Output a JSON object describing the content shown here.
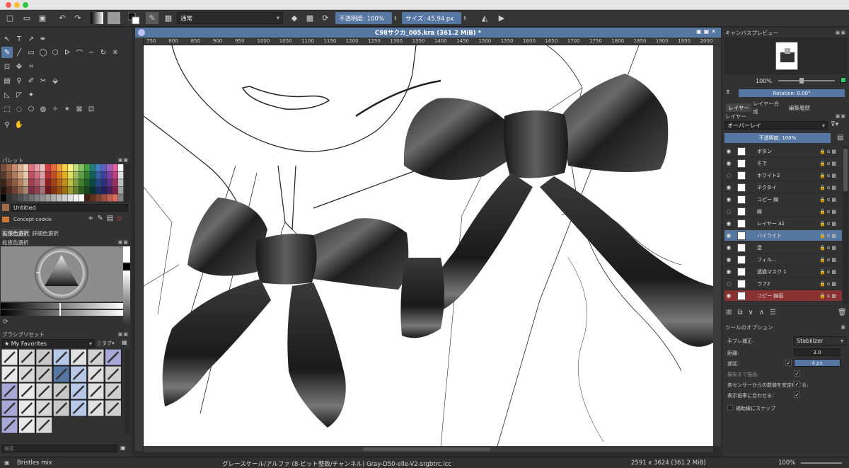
{
  "app": {
    "document_title": "C98サクカ_005.kra (361.2 MiB) *"
  },
  "toolbar": {
    "blend_mode": "通常",
    "opacity": "不透明度: 100%",
    "size": "サイズ: 45.94 px"
  },
  "left_dock": {
    "palette_title": "パレット",
    "color_name": "Untitled",
    "palette_name": "Concept-cookie",
    "selector_tabs": [
      "拡張色選択",
      "詳細色選択"
    ],
    "selector_title": "拡張色選択",
    "brush_title": "ブラシプリセット",
    "brush_tag": "My Favorites",
    "brush_tag_label": "タグ",
    "search_placeholder": "検索"
  },
  "canvas": {
    "ruler_ticks": [
      "750",
      "800",
      "850",
      "900",
      "950",
      "1000",
      "1050",
      "1100",
      "1150",
      "1200",
      "1250",
      "1300",
      "1350",
      "1400",
      "1450",
      "1500",
      "1550",
      "1600",
      "1650",
      "1700",
      "1750",
      "1800",
      "1850",
      "1900",
      "1950",
      "2000"
    ]
  },
  "right_dock": {
    "preview_title": "キャンバスプレビュー",
    "zoom": "100%",
    "rotation": "Rotation: 0.00°",
    "tabs": [
      "レイヤー",
      "レイヤー合成",
      "編集履歴"
    ],
    "layers_title": "レイヤー",
    "layer_blend": "オーバーレイ",
    "layer_opacity": "不透明度: 100%",
    "layers": [
      {
        "name": "ボタン",
        "visible": true
      },
      {
        "name": "そで",
        "visible": true
      },
      {
        "name": "ホワイト2",
        "visible": false
      },
      {
        "name": "ネクタイ",
        "visible": true
      },
      {
        "name": "コピー 線",
        "visible": true
      },
      {
        "name": "線",
        "visible": false
      },
      {
        "name": "レイヤー 32",
        "visible": true
      },
      {
        "name": "ハイライト",
        "visible": true,
        "selected": true
      },
      {
        "name": "塗",
        "visible": true
      },
      {
        "name": "フィル...",
        "visible": true
      },
      {
        "name": "透過マスク 1",
        "visible": true
      },
      {
        "name": "ラフ2",
        "visible": false
      },
      {
        "name": "コピー 線画",
        "visible": true,
        "highlight": true
      }
    ],
    "tool_options_title": "ツールのオプション",
    "smoothing_label": "手ブレ補正:",
    "smoothing_value": "Stabilizer",
    "distance_label": "距離:",
    "distance_value": "3.0",
    "delay_label": "遅延:",
    "delay_value": "4 px",
    "finish_label": "最後まで描画:",
    "pressure_label": "各センサーからの数値を安定化する:",
    "scale_label": "表示倍率に合わせる:",
    "snap_label": "補助線にスナップ"
  },
  "statusbar": {
    "brush": "Bristles mix",
    "color_space": "グレースケール/アルファ (8-ビット整数/チャンネル)  Gray-D50-elle-V2-srgbtrc.icc",
    "dimensions": "2591 x 3624 (361.2 MiB)",
    "zoom": "100%"
  }
}
